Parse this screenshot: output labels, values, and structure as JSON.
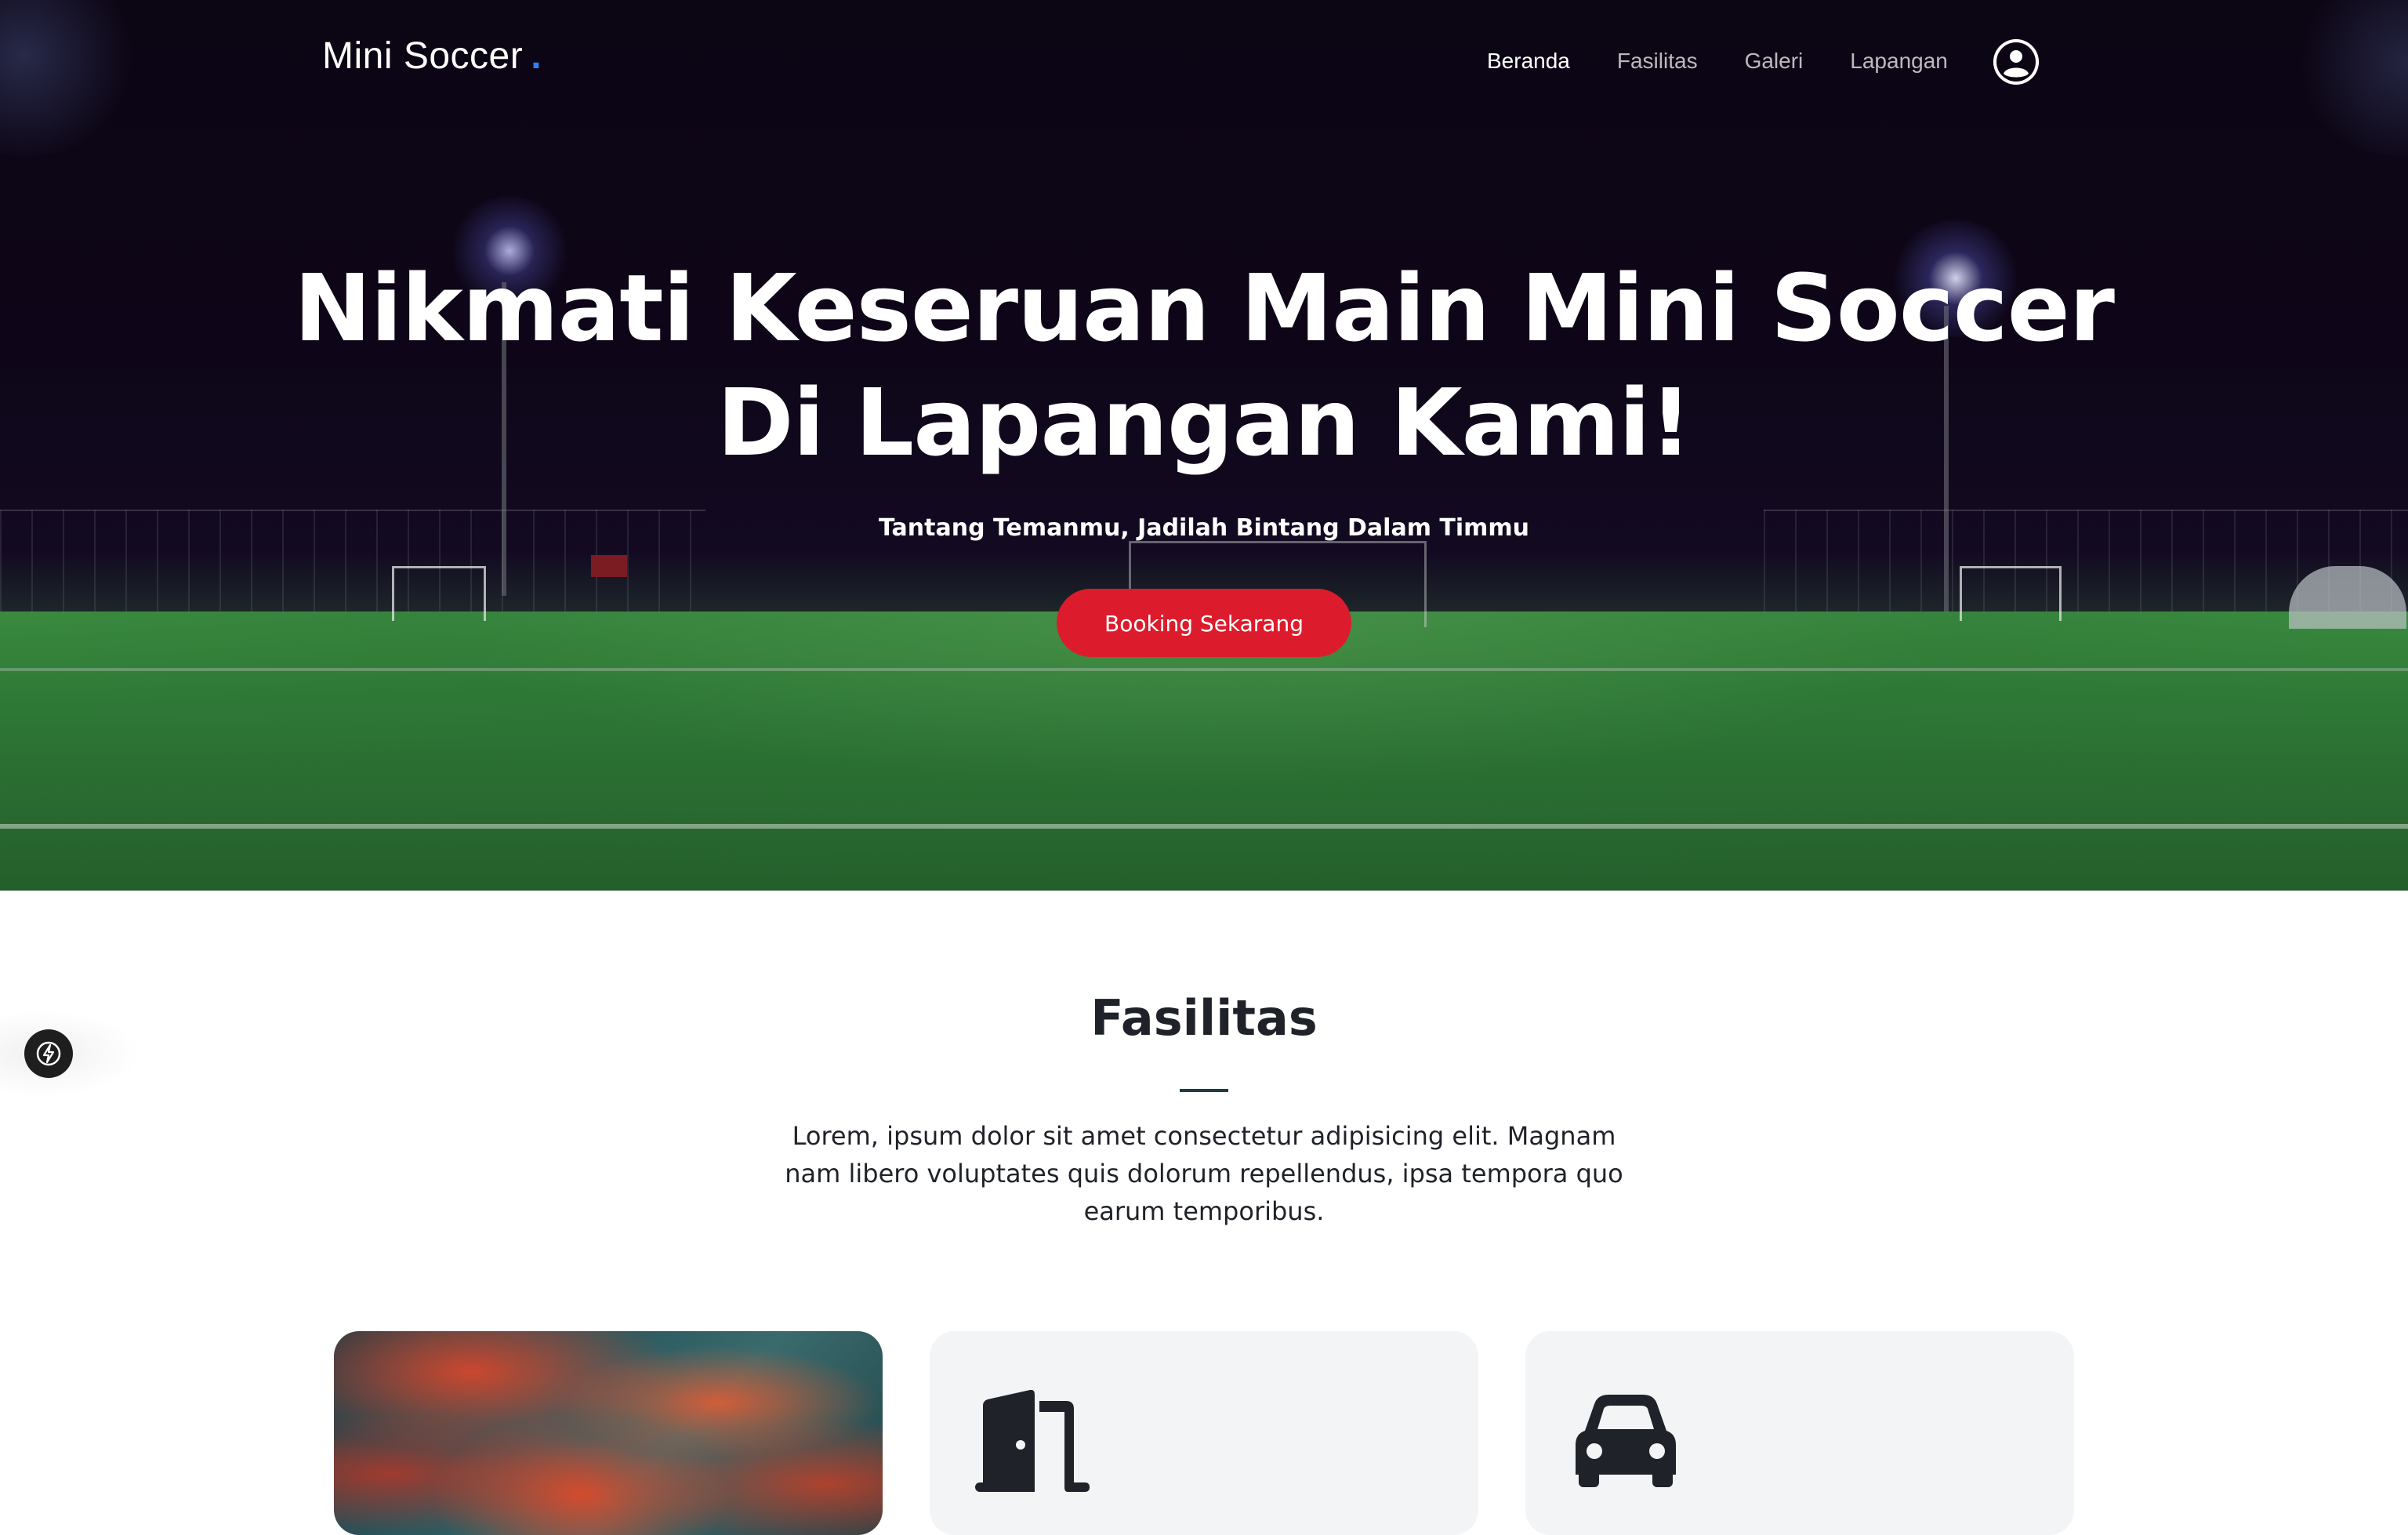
{
  "header": {
    "brand": "Mini Soccer",
    "brand_dot": ".",
    "nav": [
      {
        "label": "Beranda",
        "active": true
      },
      {
        "label": "Fasilitas",
        "active": false
      },
      {
        "label": "Galeri",
        "active": false
      },
      {
        "label": "Lapangan",
        "active": false
      }
    ],
    "user_icon": "user-circle-icon"
  },
  "hero": {
    "title_line1": "Nikmati Keseruan Main Mini Soccer",
    "title_line2": "Di Lapangan Kami!",
    "subtitle": "Tantang Temanmu, Jadilah Bintang Dalam Timmu",
    "cta_label": "Booking Sekarang"
  },
  "facilities": {
    "title": "Fasilitas",
    "description": "Lorem, ipsum dolor sit amet consectetur adipisicing elit. Magnam nam libero voluptates quis dolorum repellendus, ipsa tempora quo earum temporibus.",
    "cards": [
      {
        "icon": "sunset-photo"
      },
      {
        "icon": "door-open-icon"
      },
      {
        "icon": "car-icon"
      }
    ]
  },
  "floating_widget": {
    "icon": "lightning-bolt-icon"
  },
  "colors": {
    "accent_red": "#dc1c2c",
    "brand_blue": "#2f7df6",
    "hero_dark": "#0c0514",
    "card_bg": "#f3f4f6",
    "heading": "#1f2228"
  }
}
